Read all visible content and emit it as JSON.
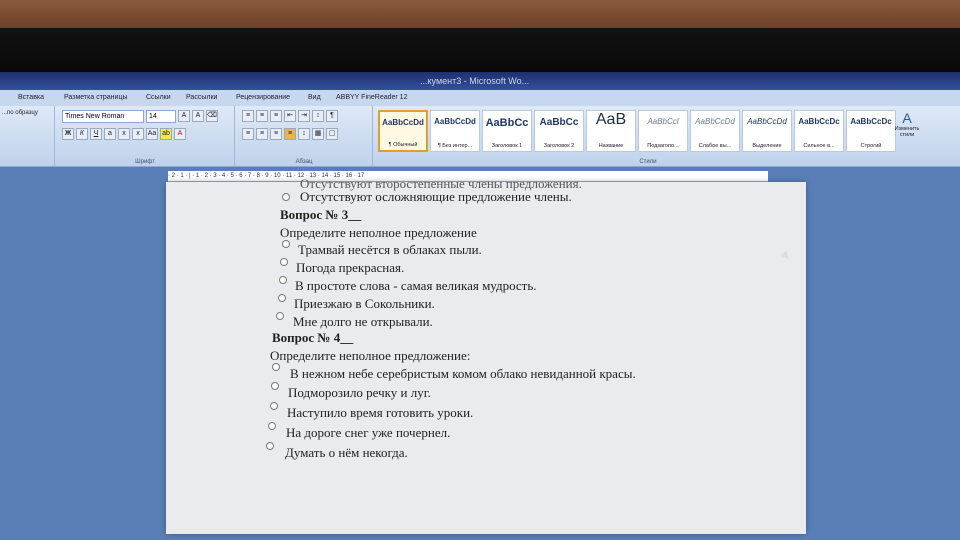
{
  "window": {
    "title": "...кумент3 - Microsoft Wo..."
  },
  "menu": [
    "Вставка",
    "Разметка страницы",
    "Ссылки",
    "Рассылки",
    "Рецензирование",
    "Вид",
    "ABBYY FineReader 12"
  ],
  "ribbon": {
    "clipboard_label": "...по образцу",
    "font_name": "Times New Roman",
    "font_size": "14",
    "font_group": "Шрифт",
    "paragraph_group": "Абзац",
    "styles_group": "Стили",
    "change_styles": "Изменить стили",
    "styles": [
      {
        "sample": "AaBbCcDd",
        "label": "¶ Обычный"
      },
      {
        "sample": "AaBbCcDd",
        "label": "¶ Без интер..."
      },
      {
        "sample": "AaBbCc",
        "label": "Заголовок 1"
      },
      {
        "sample": "AaBbCc",
        "label": "Заголовок 2"
      },
      {
        "sample": "AaB",
        "label": "Название"
      },
      {
        "sample": "AaBbCcl",
        "label": "Подзаголо..."
      },
      {
        "sample": "AaBbCcDd",
        "label": "Слабое вы..."
      },
      {
        "sample": "AaBbCcDd",
        "label": "Выделение"
      },
      {
        "sample": "AaBbCcDc",
        "label": "Сильное в..."
      },
      {
        "sample": "AaBbCcDc",
        "label": "Строгий"
      }
    ]
  },
  "ruler": "· 2 · 1 · | · 1 · 2 · 3 · 4 · 5 · 6 · 7 · 8 · 9 · 10 · 11 · 12 · 13 · 14 · 15 · 16 · 17",
  "doc": {
    "partial_top": "Отсутствуют второстепенные члены предложения.",
    "q2_last": "Отсутствуют осложняющие предложение члены.",
    "q3_title": "Вопрос № 3__",
    "q3_prompt": "Определите неполное предложение",
    "q3_options": [
      "Трамвай несётся в облаках пыли.",
      "Погода прекрасная.",
      "В простоте слова - самая великая мудрость.",
      "Приезжаю в Сокольники.",
      "Мне долго не открывали."
    ],
    "q4_title": "Вопрос № 4__",
    "q4_prompt": "Определите неполное предложение:",
    "q4_options": [
      "В нежном небе серебристым комом облако невиданной красы.",
      "Подморозило речку и луг.",
      "Наступило время готовить уроки.",
      "На дороге снег уже почернел.",
      "Думать о нём некогда."
    ]
  }
}
